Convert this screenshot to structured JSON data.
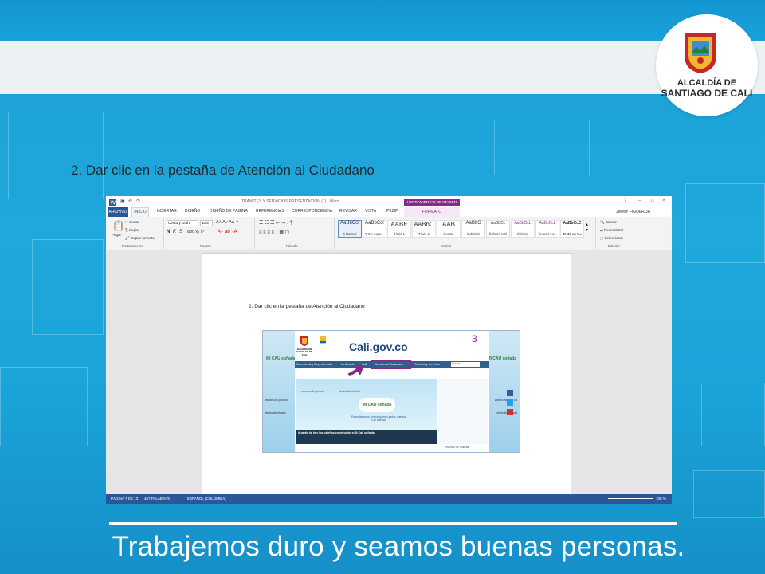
{
  "brand": {
    "line1": "ALCALDÍA DE",
    "line2": "SANTIAGO DE CALI",
    "accent": "#1ba2da",
    "shield_red": "#c62828",
    "shield_gold": "#f2b632"
  },
  "instruction": "2. Dar clic en la pestaña de Atención al Ciudadano",
  "slogan": "Trabajemos duro y seamos buenas personas.",
  "word": {
    "title": "TRÁMITES Y SERVICIOS PRESENTACION (1) - Word",
    "herramientas": "HERRAMIENTAS DE IMAGEN",
    "user": "JIMMY FIGUEROA",
    "tabs": [
      "ARCHIVO",
      "INICIO",
      "INSERTAR",
      "DISEÑO",
      "DISEÑO DE PÁGINA",
      "REFERENCIAS",
      "CORRESPONDENCIA",
      "REVISAR",
      "VISTA",
      "PKZIP",
      "FORMATO"
    ],
    "clipboard": {
      "paste": "Pegar",
      "cut": "Cortar",
      "copy": "Copiar",
      "format": "Copiar formato",
      "label": "Portapapeles"
    },
    "font": {
      "name": "Century Gothi",
      "size": "10,5",
      "label": "Fuente"
    },
    "paragraph_label": "Párrafo",
    "styles": [
      {
        "preview": "AaBbCcI",
        "name": "¶ Normal"
      },
      {
        "preview": "AaBbCcI",
        "name": "¶ Sin espa..."
      },
      {
        "preview": "AABE",
        "name": "Título 1"
      },
      {
        "preview": "AaBbC",
        "name": "Título 2"
      },
      {
        "preview": "AAB",
        "name": "Puesto"
      },
      {
        "preview": "AaBbC",
        "name": "Subtítulo"
      },
      {
        "preview": "AaBbCc",
        "name": "Énfasis sutil"
      },
      {
        "preview": "AaBbCcL",
        "name": "Énfasis"
      },
      {
        "preview": "AaBbCcL",
        "name": "Énfasis int..."
      },
      {
        "preview": "AaBbCcC",
        "name": "Texto en n..."
      }
    ],
    "styles_label": "Estilos",
    "edit": {
      "find": "Buscar",
      "replace": "Reemplazar",
      "select": "Seleccionar",
      "label": "Edición"
    },
    "page_text": "2.  Dar clic en la pestaña de Atención al Ciudadano",
    "site": {
      "domain": "Cali.gov.co",
      "logo_line1": "ALCALDÍA DE",
      "logo_line2": "SANTIAGO DE CALI",
      "nav": [
        "Secretarías y Dependencias",
        "La Alcaldía",
        "Cali",
        "Atención al Ciudadano",
        "Trámites y servicios"
      ],
      "search": "Buscar",
      "banner_left": "www.cali.gov.co",
      "banner_hashtag": "#micalisoñada",
      "mi_cali": "MI CAU soñada",
      "banner_caption": "Entendámonos, construyamos juntos nuestra Cali soñada",
      "news_title": "A partir de hoy los caleños construirán a Mi Cali soñada",
      "day": "3",
      "history": "Histórico de noticias"
    },
    "status": {
      "page": "PÁGINA 7 DE 13",
      "words": "467 PALABRAS",
      "lang": "ESPAÑOL (COLOMBIA)",
      "zoom": "100 %"
    }
  }
}
